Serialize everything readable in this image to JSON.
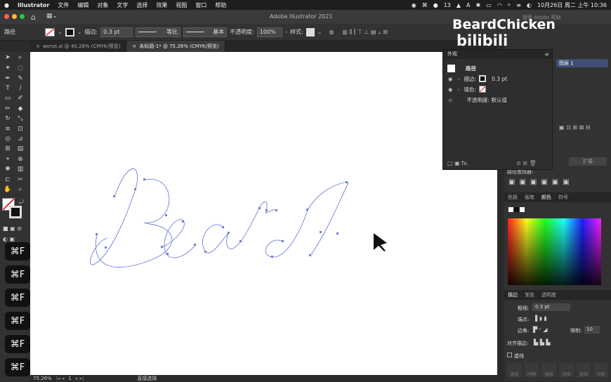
{
  "menubar": {
    "apple_icon": "apple-icon",
    "items": [
      "Illustrator",
      "文件",
      "编辑",
      "对象",
      "文字",
      "选择",
      "效果",
      "视图",
      "窗口",
      "帮助"
    ],
    "battery_badge": "13",
    "clock": "10月26日 周二 上午 10:36"
  },
  "titlebar": {
    "title": "Adobe Illustrator 2021",
    "search_placeholder": "搜索 Adobe 帮助"
  },
  "controlbar": {
    "selection_label": "路径",
    "stroke_label": "描边:",
    "stroke_value": "0.3 pt",
    "profile_label": "等比",
    "brush_label": "基本",
    "opacity_label": "不透明度:",
    "opacity_value": "100%",
    "style_label": "样式:",
    "transform_label": "变换"
  },
  "tabs": [
    {
      "label": "wenzi.ai @ 40.28% (CMYK/预览)",
      "active": false
    },
    {
      "label": "未标题-1* @ 75.26% (CMYK/预览)",
      "active": true
    }
  ],
  "appearance": {
    "header": "外观",
    "title": "路径",
    "stroke_label": "描边:",
    "stroke_value": "0.3 pt",
    "fill_label": "填色:",
    "opacity_text": "不透明度: 默认值"
  },
  "status": {
    "zoom": "75.26%",
    "page": "1",
    "tool": "直接选择"
  },
  "shortcut_overlays": [
    "⌘F",
    "⌘F",
    "⌘F",
    "⌘F",
    "⌘F",
    "⌘F"
  ],
  "watermark": {
    "text": "BeardChicken",
    "logo": "bilibili"
  },
  "dock": {
    "layer_name": "图层 1",
    "pathfinder_title": "路径查找器:",
    "expand_label": "扩展",
    "color_tabs": [
      "色板",
      "画笔",
      "颜色",
      "符号"
    ],
    "stroke_tabs": [
      "描边",
      "渐变",
      "透明度"
    ],
    "weight_label": "粗细:",
    "weight_value": "0.3 pt",
    "cap_label": "端点:",
    "corner_label": "边角:",
    "limit_label": "限制:",
    "limit_value": "10",
    "align_label": "对齐描边:",
    "dashed_label": "虚线",
    "dash_labels": [
      "虚线",
      "间隙",
      "虚线",
      "间隙",
      "虚线",
      "间隙"
    ]
  },
  "colors": {
    "canvas": "#ffffff",
    "path": "#6f7fd6",
    "accent": "#e03030"
  }
}
